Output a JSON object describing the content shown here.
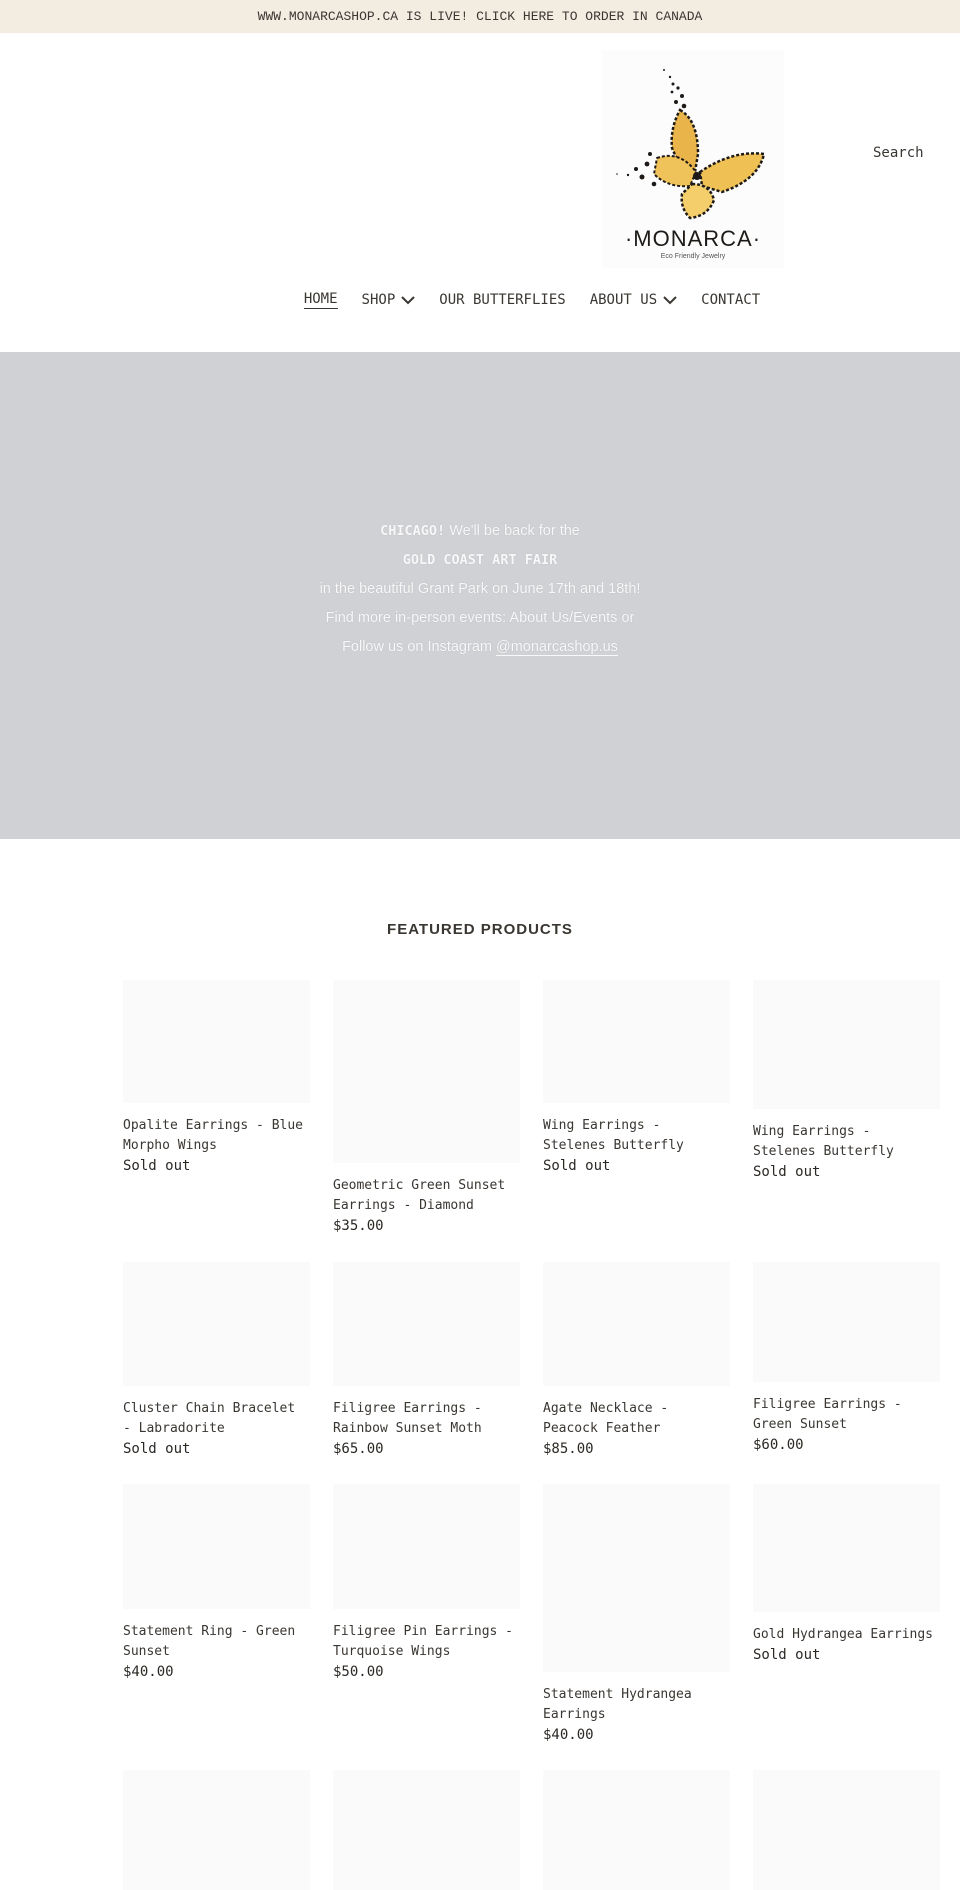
{
  "announcement": {
    "text": "WWW.MONARCASHOP.CA IS LIVE! CLICK HERE TO ORDER IN CANADA"
  },
  "header": {
    "logo": {
      "brand": "·MONARCA·",
      "tagline": "Eco Friendly Jewelry",
      "icon": "butterfly-logo-icon"
    },
    "search_label": "Search",
    "nav": [
      {
        "label": "HOME",
        "active": true,
        "dropdown": false
      },
      {
        "label": "SHOP",
        "active": false,
        "dropdown": true
      },
      {
        "label": "OUR BUTTERFLIES",
        "active": false,
        "dropdown": false
      },
      {
        "label": "ABOUT US",
        "active": false,
        "dropdown": true
      },
      {
        "label": "CONTACT",
        "active": false,
        "dropdown": false
      }
    ]
  },
  "hero": {
    "line1_bold": "CHICAGO!",
    "line1_rest": " We'll be back for the",
    "line2": "GOLD COAST ART FAIR",
    "line3": "in the beautiful Grant Park on June 17th and 18th!",
    "line4": "Find more in-person events: About Us/Events or",
    "line5_prefix": "Follow us on Instagram ",
    "line5_link": "@monarcashop.us"
  },
  "featured": {
    "title": "FEATURED PRODUCTS",
    "products": [
      {
        "name": "Opalite Earrings - Blue Morpho Wings",
        "price": "Sold out"
      },
      {
        "name": "Geometric Green Sunset Earrings - Diamond",
        "price": "$35.00"
      },
      {
        "name": "Wing Earrings - Stelenes Butterfly",
        "price": "Sold out"
      },
      {
        "name": "Wing Earrings - Stelenes Butterfly",
        "price": "Sold out"
      },
      {
        "name": "Cluster Chain Bracelet - Labradorite",
        "price": "Sold out"
      },
      {
        "name": "Filigree Earrings - Rainbow Sunset Moth",
        "price": "$65.00"
      },
      {
        "name": "Agate Necklace - Peacock Feather",
        "price": "$85.00"
      },
      {
        "name": "Filigree Earrings - Green Sunset",
        "price": "$60.00"
      },
      {
        "name": "Statement Ring - Green Sunset",
        "price": "$40.00"
      },
      {
        "name": "Filigree Pin Earrings - Turquoise Wings",
        "price": "$50.00"
      },
      {
        "name": "Statement Hydrangea Earrings",
        "price": "$40.00"
      },
      {
        "name": "Gold Hydrangea Earrings",
        "price": "Sold out"
      },
      {
        "name": "",
        "price": ""
      },
      {
        "name": "",
        "price": ""
      },
      {
        "name": "",
        "price": ""
      },
      {
        "name": "",
        "price": ""
      }
    ]
  },
  "colors": {
    "announcement_bg": "#f3ece1",
    "hero_bg": "#d0d1d5",
    "text": "#3a3632",
    "placeholder": "#fafafa"
  }
}
